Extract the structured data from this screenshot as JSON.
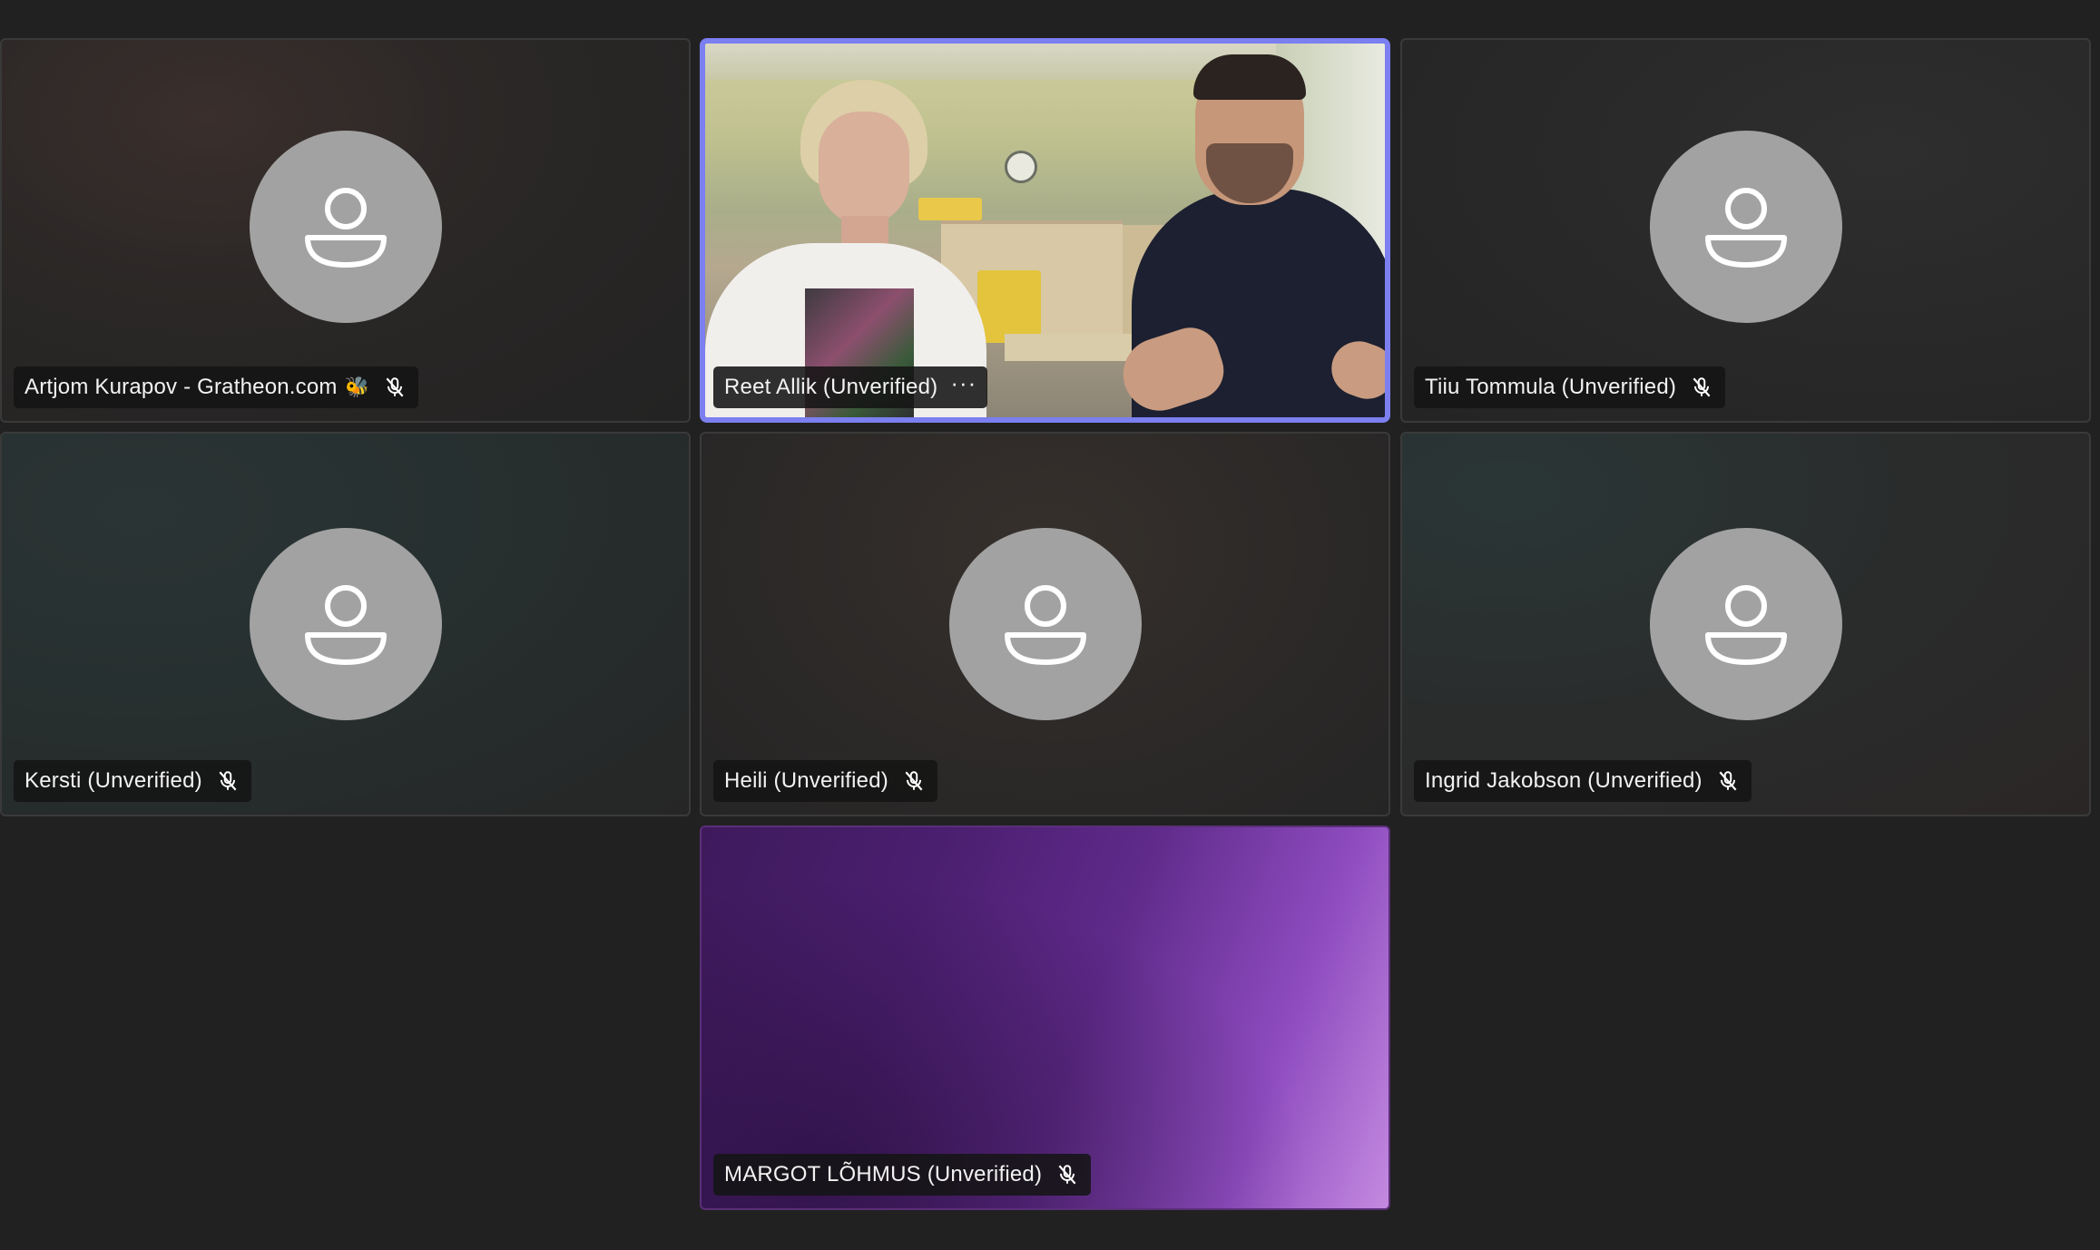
{
  "participants": [
    {
      "name": "Artjom Kurapov - Gratheon.com",
      "badge_emoji": "🐝",
      "mic": "muted",
      "video": false
    },
    {
      "name": "Reet Allik (Unverified)",
      "more_label": "···",
      "mic": "on",
      "video": true,
      "active_speaker": true
    },
    {
      "name": "Tiiu Tommula (Unverified)",
      "mic": "muted",
      "video": false
    },
    {
      "name": "Kersti (Unverified)",
      "mic": "muted",
      "video": false
    },
    {
      "name": "Heili (Unverified)",
      "mic": "muted",
      "video": false
    },
    {
      "name": "Ingrid Jakobson (Unverified)",
      "mic": "muted",
      "video": false
    },
    {
      "name": "MARGOT LÕHMUS (Unverified)",
      "mic": "muted",
      "video": true
    }
  ],
  "icons": {
    "avatar": "person-placeholder-icon",
    "mic": "mic-muted-icon",
    "more": "more-options-icon"
  },
  "colors": {
    "background": "#212121",
    "active_border": "#7b7ff0",
    "avatar_circle": "#a2a2a2"
  }
}
